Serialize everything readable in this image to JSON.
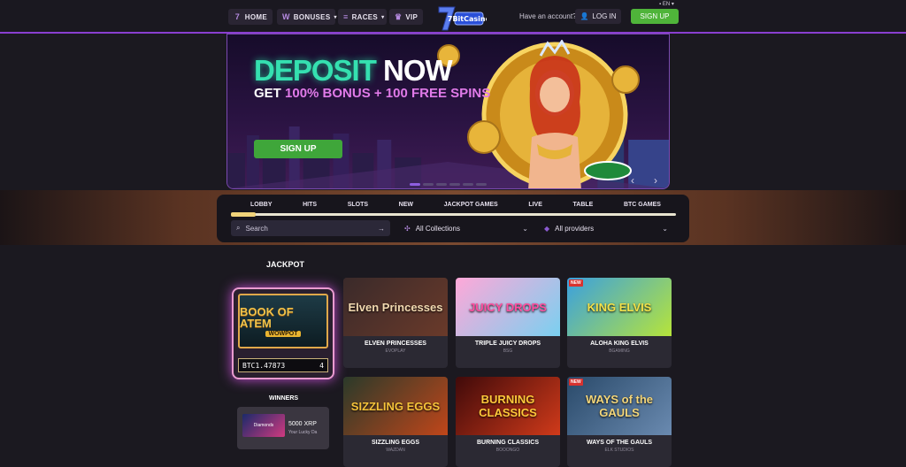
{
  "nav": {
    "home": "HOME",
    "bonuses": "BONUSES",
    "races": "RACES",
    "vip": "VIP",
    "lang": "EN",
    "have_account": "Have an account?",
    "login": "LOG IN",
    "signup": "SIGN UP",
    "logo_text": "7BitCasino"
  },
  "banner": {
    "title_a": "DEPOSIT",
    "title_b": "NOW",
    "sub_a": "GET",
    "sub_b": "100% BONUS + 100 FREE SPINS",
    "cta": "SIGN UP",
    "slide_count": 6,
    "active_slide": 0
  },
  "filters": {
    "categories": [
      "LOBBY",
      "HITS",
      "SLOTS",
      "NEW",
      "JACKPOT GAMES",
      "LIVE",
      "TABLE",
      "BTC GAMES"
    ],
    "search_placeholder": "Search",
    "collections": "All Collections",
    "providers": "All providers"
  },
  "jackpot": {
    "title": "JACKPOT",
    "game_title": "BOOK OF ATEM",
    "game_subtitle": "WOWPOT",
    "value_prefix": "BTC1.47873",
    "value_suffix": "4"
  },
  "winners": {
    "title": "WINNERS",
    "amount": "5000 XRP",
    "game": "Your Lucky Da",
    "thumb_label": "Diamonds"
  },
  "games": [
    {
      "name": "ELVEN PRINCESSES",
      "provider": "EVOPLAY",
      "thumb_text": "Elven Princesses",
      "new": false
    },
    {
      "name": "TRIPLE JUICY DROPS",
      "provider": "BSG",
      "thumb_text": "JUICY DROPS",
      "new": false
    },
    {
      "name": "ALOHA KING ELVIS",
      "provider": "BGAMING",
      "thumb_text": "KING ELVIS",
      "new": true
    },
    {
      "name": "SIZZLING EGGS",
      "provider": "WAZDAN",
      "thumb_text": "SIZZLING EGGS",
      "new": false
    },
    {
      "name": "BURNING CLASSICS",
      "provider": "BOOONGO",
      "thumb_text": "BURNING CLASSICS",
      "new": false
    },
    {
      "name": "WAYS OF THE GAULS",
      "provider": "ELK STUDIOS",
      "thumb_text": "WAYS of the GAULS",
      "new": true
    }
  ],
  "badge_new": "NEW",
  "colors": {
    "accent": "#8a3fd0",
    "green": "#4fb43a",
    "deposit": "#35e0b0"
  }
}
